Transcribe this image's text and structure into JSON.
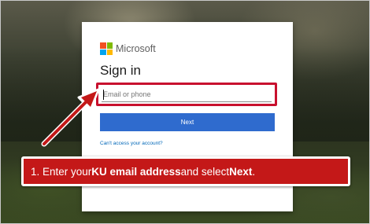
{
  "signin": {
    "brand": "Microsoft",
    "title": "Sign in",
    "email_placeholder": "Email or phone",
    "next_label": "Next",
    "cant_access_link": "Can't access your account?"
  },
  "instruction": {
    "prefix": "1. Enter your ",
    "bold1": "KU email address",
    "middle": " and select ",
    "bold2": "Next",
    "suffix": "."
  },
  "colors": {
    "highlight_red": "#c8102e",
    "callout_red": "#c41818",
    "button_blue": "#2f6bce",
    "link_blue": "#0067b8",
    "logo_red": "#f25022",
    "logo_green": "#7fba00",
    "logo_blue": "#00a4ef",
    "logo_yellow": "#ffb900"
  },
  "icons": {
    "logo": "microsoft-logo-icon",
    "arrow": "red-arrow-icon"
  }
}
